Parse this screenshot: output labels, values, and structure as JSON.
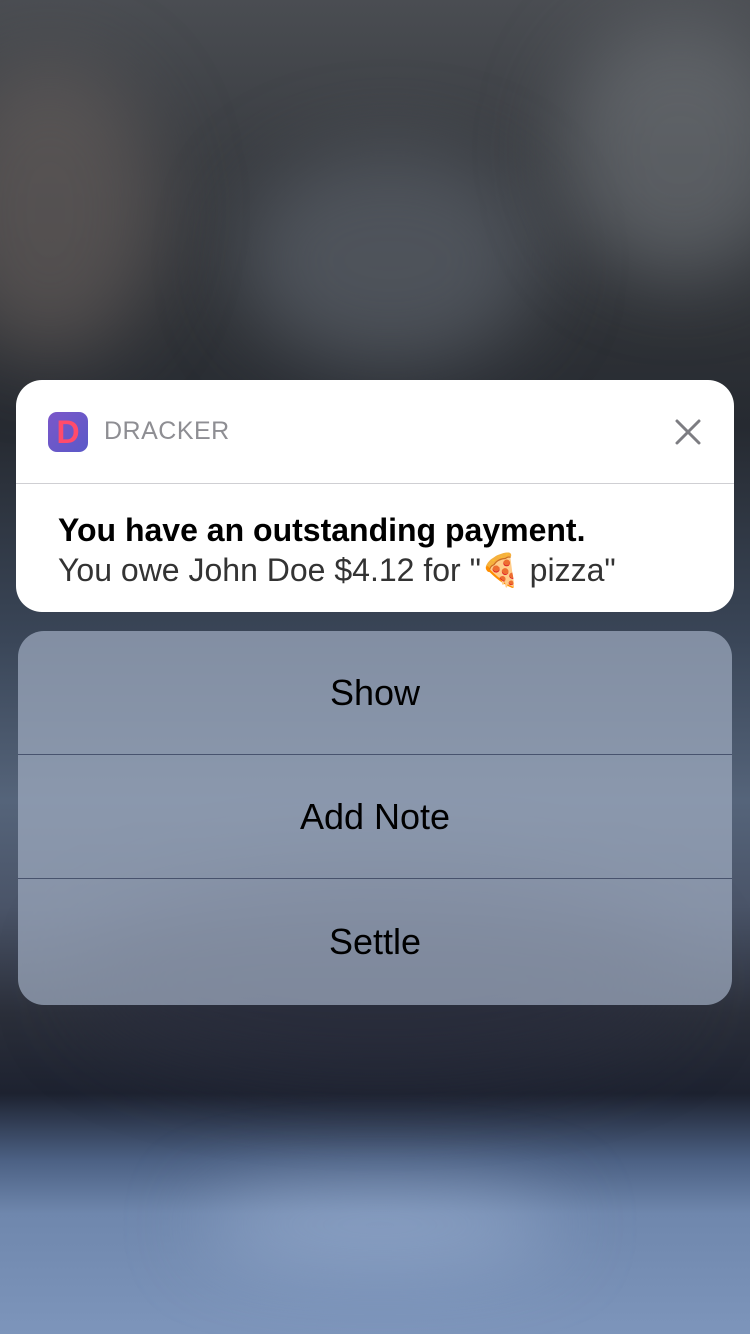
{
  "notification": {
    "app_name": "DRACKER",
    "app_icon_letter": "D",
    "title": "You have an outstanding payment.",
    "message": "You owe John Doe $4.12 for \"🍕 pizza\"",
    "close_icon": "close-icon"
  },
  "actions": [
    {
      "label": "Show"
    },
    {
      "label": "Add Note"
    },
    {
      "label": "Settle"
    }
  ],
  "colors": {
    "app_icon_bg": "#6a58c8",
    "app_icon_letter": "#ff4b6b"
  }
}
